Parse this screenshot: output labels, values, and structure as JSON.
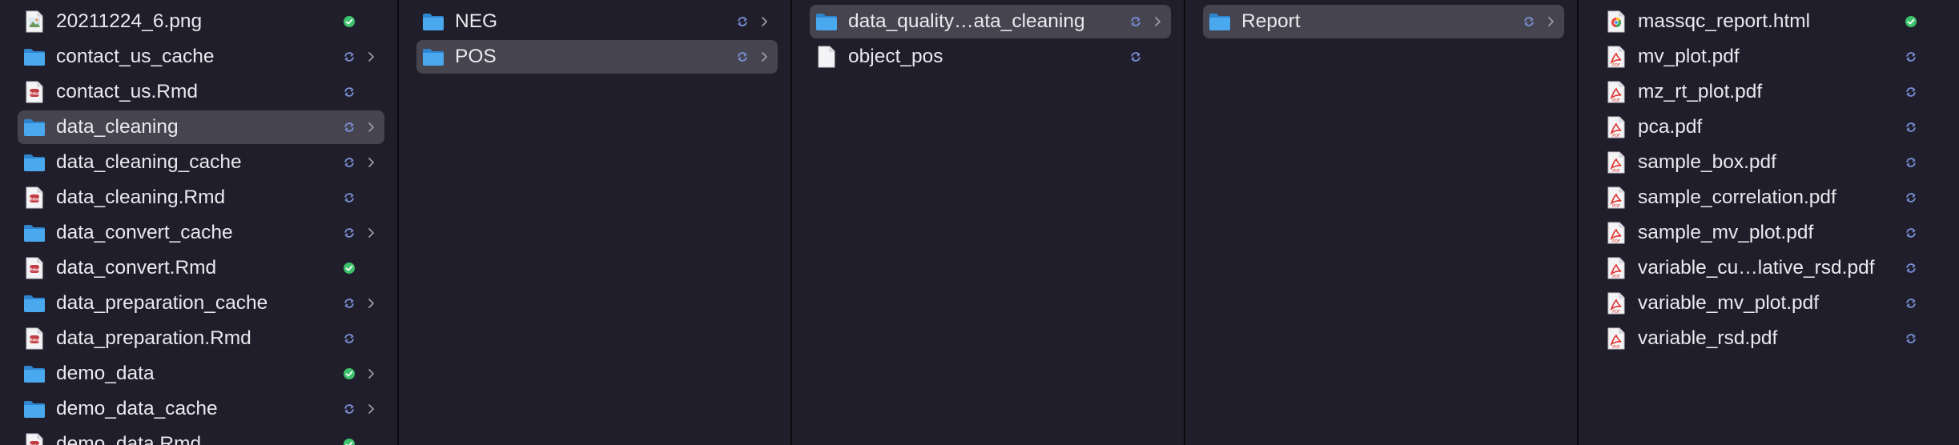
{
  "columns": [
    {
      "items": [
        {
          "name": "20211224_6.png",
          "kind": "image",
          "status": "synced",
          "folder": false,
          "selected": false
        },
        {
          "name": "contact_us_cache",
          "kind": "folder",
          "status": "syncing",
          "folder": true,
          "selected": false
        },
        {
          "name": "contact_us.Rmd",
          "kind": "rmd",
          "status": "syncing",
          "folder": false,
          "selected": false
        },
        {
          "name": "data_cleaning",
          "kind": "folder",
          "status": "syncing",
          "folder": true,
          "selected": true
        },
        {
          "name": "data_cleaning_cache",
          "kind": "folder",
          "status": "syncing",
          "folder": true,
          "selected": false
        },
        {
          "name": "data_cleaning.Rmd",
          "kind": "rmd",
          "status": "syncing",
          "folder": false,
          "selected": false
        },
        {
          "name": "data_convert_cache",
          "kind": "folder",
          "status": "syncing",
          "folder": true,
          "selected": false
        },
        {
          "name": "data_convert.Rmd",
          "kind": "rmd",
          "status": "synced",
          "folder": false,
          "selected": false
        },
        {
          "name": "data_preparation_cache",
          "kind": "folder",
          "status": "syncing",
          "folder": true,
          "selected": false
        },
        {
          "name": "data_preparation.Rmd",
          "kind": "rmd",
          "status": "syncing",
          "folder": false,
          "selected": false
        },
        {
          "name": "demo_data",
          "kind": "folder",
          "status": "synced",
          "folder": true,
          "selected": false
        },
        {
          "name": "demo_data_cache",
          "kind": "folder",
          "status": "syncing",
          "folder": true,
          "selected": false
        },
        {
          "name": "demo_data.Rmd",
          "kind": "rmd",
          "status": "synced",
          "folder": false,
          "selected": false
        }
      ]
    },
    {
      "items": [
        {
          "name": "NEG",
          "kind": "folder",
          "status": "syncing",
          "folder": true,
          "selected": false
        },
        {
          "name": "POS",
          "kind": "folder",
          "status": "syncing",
          "folder": true,
          "selected": true
        }
      ]
    },
    {
      "items": [
        {
          "name": "data_quality…ata_cleaning",
          "kind": "folder",
          "status": "syncing",
          "folder": true,
          "selected": true
        },
        {
          "name": "object_pos",
          "kind": "file",
          "status": "syncing",
          "folder": false,
          "selected": false
        }
      ]
    },
    {
      "items": [
        {
          "name": "Report",
          "kind": "folder",
          "status": "syncing",
          "folder": true,
          "selected": true
        }
      ]
    },
    {
      "items": [
        {
          "name": "massqc_report.html",
          "kind": "html",
          "status": "synced",
          "folder": false,
          "selected": false
        },
        {
          "name": "mv_plot.pdf",
          "kind": "pdf",
          "status": "syncing",
          "folder": false,
          "selected": false
        },
        {
          "name": "mz_rt_plot.pdf",
          "kind": "pdf",
          "status": "syncing",
          "folder": false,
          "selected": false
        },
        {
          "name": "pca.pdf",
          "kind": "pdf",
          "status": "syncing",
          "folder": false,
          "selected": false
        },
        {
          "name": "sample_box.pdf",
          "kind": "pdf",
          "status": "syncing",
          "folder": false,
          "selected": false
        },
        {
          "name": "sample_correlation.pdf",
          "kind": "pdf",
          "status": "syncing",
          "folder": false,
          "selected": false
        },
        {
          "name": "sample_mv_plot.pdf",
          "kind": "pdf",
          "status": "syncing",
          "folder": false,
          "selected": false
        },
        {
          "name": "variable_cu…lative_rsd.pdf",
          "kind": "pdf",
          "status": "syncing",
          "folder": false,
          "selected": false
        },
        {
          "name": "variable_mv_plot.pdf",
          "kind": "pdf",
          "status": "syncing",
          "folder": false,
          "selected": false
        },
        {
          "name": "variable_rsd.pdf",
          "kind": "pdf",
          "status": "syncing",
          "folder": false,
          "selected": false
        }
      ]
    }
  ],
  "colors": {
    "background": "#1f1e2a",
    "selection": "#46454f",
    "folder": "#4aa8ee",
    "synced": "#3cc26c",
    "syncing": "#7a8fd6",
    "pdf": "#e0342e",
    "rmd": "#c23c44"
  }
}
